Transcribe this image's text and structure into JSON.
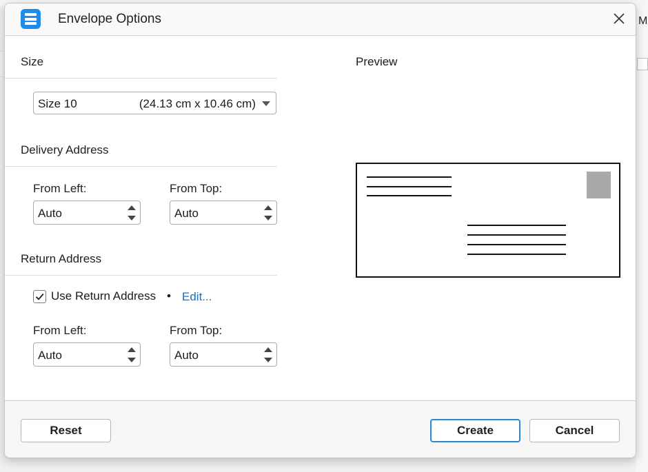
{
  "background": {
    "partial_text": "M"
  },
  "dialog": {
    "title": "Envelope Options",
    "accent_color": "#1c8cf0",
    "icons": {
      "app": "list-icon",
      "close": "close-icon"
    }
  },
  "size_section": {
    "label": "Size",
    "select": {
      "value": "Size 10",
      "dimensions": "(24.13 cm x 10.46 cm)"
    }
  },
  "delivery_section": {
    "label": "Delivery Address",
    "from_left_label": "From Left:",
    "from_left_value": "Auto",
    "from_top_label": "From Top:",
    "from_top_value": "Auto"
  },
  "return_section": {
    "label": "Return Address",
    "use_return_label": "Use Return Address",
    "use_return_checked": true,
    "separator": "•",
    "edit_link": "Edit...",
    "from_left_label": "From Left:",
    "from_left_value": "Auto",
    "from_top_label": "From Top:",
    "from_top_value": "Auto"
  },
  "preview": {
    "label": "Preview"
  },
  "footer": {
    "reset_label": "Reset",
    "create_label": "Create",
    "cancel_label": "Cancel"
  }
}
